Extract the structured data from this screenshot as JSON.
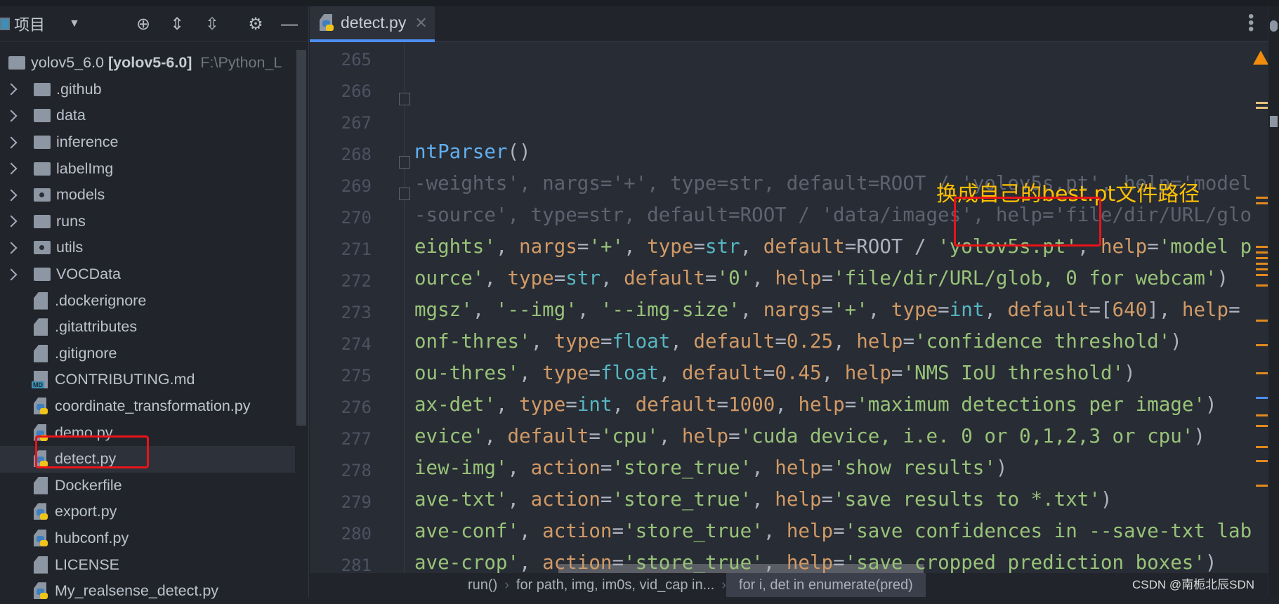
{
  "sidebar": {
    "title": "项目",
    "root": {
      "name": "yolov5_6.0",
      "module": "[yolov5-6.0]",
      "path": "F:\\Python_L"
    },
    "items": [
      {
        "label": ".github",
        "type": "folder"
      },
      {
        "label": "data",
        "type": "folder"
      },
      {
        "label": "inference",
        "type": "folder"
      },
      {
        "label": "labelImg",
        "type": "folder"
      },
      {
        "label": "models",
        "type": "package"
      },
      {
        "label": "runs",
        "type": "folder"
      },
      {
        "label": "utils",
        "type": "package"
      },
      {
        "label": "VOCData",
        "type": "folder"
      },
      {
        "label": ".dockerignore",
        "type": "text"
      },
      {
        "label": ".gitattributes",
        "type": "text"
      },
      {
        "label": ".gitignore",
        "type": "ignore"
      },
      {
        "label": "CONTRIBUTING.md",
        "type": "md"
      },
      {
        "label": "coordinate_transformation.py",
        "type": "py"
      },
      {
        "label": "demo.py",
        "type": "py"
      },
      {
        "label": "detect.py",
        "type": "py",
        "selected": true
      },
      {
        "label": "Dockerfile",
        "type": "docker"
      },
      {
        "label": "export.py",
        "type": "py"
      },
      {
        "label": "hubconf.py",
        "type": "py"
      },
      {
        "label": "LICENSE",
        "type": "text"
      },
      {
        "label": "My_realsense_detect.py",
        "type": "py"
      }
    ]
  },
  "editor": {
    "tab": "detect.py",
    "line_numbers": [
      "265",
      "266",
      "267",
      "268",
      "269",
      "270",
      "271",
      "272",
      "273",
      "274",
      "275",
      "276",
      "277",
      "278",
      "279",
      "280",
      "281"
    ],
    "lines": [
      [],
      [],
      [],
      [
        [
          "ntParser",
          "f"
        ],
        [
          "()",
          "p"
        ]
      ],
      [
        [
          "-weights', nargs='+', type=str, default=ROOT / 'yolov5s.pt', help='model",
          "dim"
        ]
      ],
      [
        [
          "-source', type=str, default=ROOT / 'data/images', help='file/dir/URL/glo",
          "dim"
        ]
      ],
      [
        [
          "eights'",
          "s"
        ],
        [
          ", ",
          "p"
        ],
        [
          "nargs",
          "k"
        ],
        [
          "=",
          "p"
        ],
        [
          "'+'",
          "s"
        ],
        [
          ", ",
          "p"
        ],
        [
          "type",
          "k"
        ],
        [
          "=",
          "p"
        ],
        [
          "str",
          "t"
        ],
        [
          ", ",
          "p"
        ],
        [
          "default",
          "k"
        ],
        [
          "=ROOT / ",
          "p"
        ],
        [
          "'yolov5s.pt'",
          "s"
        ],
        [
          ", ",
          "p"
        ],
        [
          "help",
          "k"
        ],
        [
          "=",
          "p"
        ],
        [
          "'model p",
          "s"
        ]
      ],
      [
        [
          "ource'",
          "s"
        ],
        [
          ", ",
          "p"
        ],
        [
          "type",
          "k"
        ],
        [
          "=",
          "p"
        ],
        [
          "str",
          "t"
        ],
        [
          ", ",
          "p"
        ],
        [
          "default",
          "k"
        ],
        [
          "=",
          "p"
        ],
        [
          "'0'",
          "s"
        ],
        [
          ", ",
          "p"
        ],
        [
          "help",
          "k"
        ],
        [
          "=",
          "p"
        ],
        [
          "'file/dir/URL/glob, 0 for webcam'",
          "s"
        ],
        [
          ")",
          "p"
        ]
      ],
      [
        [
          "mgsz'",
          "s"
        ],
        [
          ", ",
          "p"
        ],
        [
          "'--img'",
          "s"
        ],
        [
          ", ",
          "p"
        ],
        [
          "'--img-size'",
          "s"
        ],
        [
          ", ",
          "p"
        ],
        [
          "nargs",
          "k"
        ],
        [
          "=",
          "p"
        ],
        [
          "'+'",
          "s"
        ],
        [
          ", ",
          "p"
        ],
        [
          "type",
          "k"
        ],
        [
          "=",
          "p"
        ],
        [
          "int",
          "t"
        ],
        [
          ", ",
          "p"
        ],
        [
          "default",
          "k"
        ],
        [
          "=[",
          "p"
        ],
        [
          "640",
          "k"
        ],
        [
          "], ",
          "p"
        ],
        [
          "help",
          "k"
        ],
        [
          "=",
          "p"
        ]
      ],
      [
        [
          "onf-thres'",
          "s"
        ],
        [
          ", ",
          "p"
        ],
        [
          "type",
          "k"
        ],
        [
          "=",
          "p"
        ],
        [
          "float",
          "t"
        ],
        [
          ", ",
          "p"
        ],
        [
          "default",
          "k"
        ],
        [
          "=",
          "p"
        ],
        [
          "0.25",
          "k"
        ],
        [
          ", ",
          "p"
        ],
        [
          "help",
          "k"
        ],
        [
          "=",
          "p"
        ],
        [
          "'confidence threshold'",
          "s"
        ],
        [
          ")",
          "p"
        ]
      ],
      [
        [
          "ou-thres'",
          "s"
        ],
        [
          ", ",
          "p"
        ],
        [
          "type",
          "k"
        ],
        [
          "=",
          "p"
        ],
        [
          "float",
          "t"
        ],
        [
          ", ",
          "p"
        ],
        [
          "default",
          "k"
        ],
        [
          "=",
          "p"
        ],
        [
          "0.45",
          "k"
        ],
        [
          ", ",
          "p"
        ],
        [
          "help",
          "k"
        ],
        [
          "=",
          "p"
        ],
        [
          "'NMS IoU threshold'",
          "s"
        ],
        [
          ")",
          "p"
        ]
      ],
      [
        [
          "ax-det'",
          "s"
        ],
        [
          ", ",
          "p"
        ],
        [
          "type",
          "k"
        ],
        [
          "=",
          "p"
        ],
        [
          "int",
          "t"
        ],
        [
          ", ",
          "p"
        ],
        [
          "default",
          "k"
        ],
        [
          "=",
          "p"
        ],
        [
          "1000",
          "k"
        ],
        [
          ", ",
          "p"
        ],
        [
          "help",
          "k"
        ],
        [
          "=",
          "p"
        ],
        [
          "'maximum detections per image'",
          "s"
        ],
        [
          ")",
          "p"
        ]
      ],
      [
        [
          "evice'",
          "s"
        ],
        [
          ", ",
          "p"
        ],
        [
          "default",
          "k"
        ],
        [
          "=",
          "p"
        ],
        [
          "'cpu'",
          "s"
        ],
        [
          ", ",
          "p"
        ],
        [
          "help",
          "k"
        ],
        [
          "=",
          "p"
        ],
        [
          "'cuda device, i.e. 0 or 0,1,2,3 or cpu'",
          "s"
        ],
        [
          ")",
          "p"
        ]
      ],
      [
        [
          "iew-img'",
          "s"
        ],
        [
          ", ",
          "p"
        ],
        [
          "action",
          "k"
        ],
        [
          "=",
          "p"
        ],
        [
          "'store_true'",
          "s"
        ],
        [
          ", ",
          "p"
        ],
        [
          "help",
          "k"
        ],
        [
          "=",
          "p"
        ],
        [
          "'show results'",
          "s"
        ],
        [
          ")",
          "p"
        ]
      ],
      [
        [
          "ave-txt'",
          "s"
        ],
        [
          ", ",
          "p"
        ],
        [
          "action",
          "k"
        ],
        [
          "=",
          "p"
        ],
        [
          "'store_true'",
          "s"
        ],
        [
          ", ",
          "p"
        ],
        [
          "help",
          "k"
        ],
        [
          "=",
          "p"
        ],
        [
          "'save results to *.txt'",
          "s"
        ],
        [
          ")",
          "p"
        ]
      ],
      [
        [
          "ave-conf'",
          "s"
        ],
        [
          ", ",
          "p"
        ],
        [
          "action",
          "k"
        ],
        [
          "=",
          "p"
        ],
        [
          "'store_true'",
          "s"
        ],
        [
          ", ",
          "p"
        ],
        [
          "help",
          "k"
        ],
        [
          "=",
          "p"
        ],
        [
          "'save confidences in --save-txt lab",
          "s"
        ]
      ],
      [
        [
          "ave-crop'",
          "s"
        ],
        [
          ", ",
          "p"
        ],
        [
          "action",
          "k"
        ],
        [
          "=",
          "p"
        ],
        [
          "'store_true'",
          "s"
        ],
        [
          ", ",
          "p"
        ],
        [
          "help",
          "k"
        ],
        [
          "=",
          "p"
        ],
        [
          "'save cropped prediction boxes'",
          "s"
        ],
        [
          ")",
          "p"
        ]
      ]
    ],
    "breadcrumb": [
      "run()",
      "for path, img, im0s, vid_cap in...",
      "for i, det in enumerate(pred)"
    ]
  },
  "annotation": {
    "text": "换成自己的best.pt文件路径",
    "color": "#ffc000",
    "box_color": "#e8141a"
  },
  "watermark": "CSDN @南栀北辰SDN",
  "colors": {
    "string": "#98c379",
    "keyword_arg": "#d19a66",
    "builtin": "#56b6c2",
    "tab_underline": "#4d8ef0",
    "warning": "#f28c0f"
  }
}
